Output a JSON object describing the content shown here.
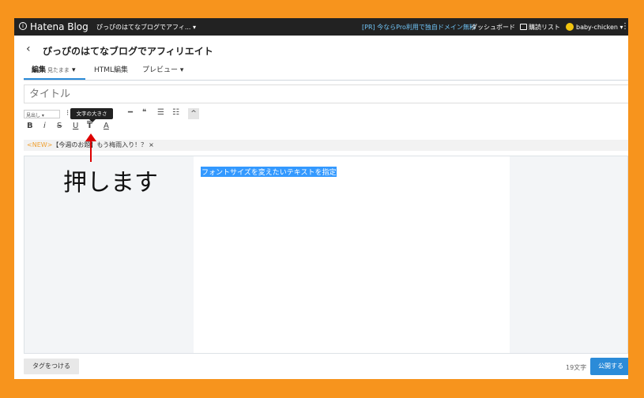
{
  "colors": {
    "frame": "#f7941d",
    "topbar": "#222222",
    "accent": "#2b8bd8",
    "promo": "#6fc3f5",
    "arrow": "#dd0000",
    "selection": "#3399ff",
    "new_badge": "#f0a030"
  },
  "topbar": {
    "brand": "Hatena Blog",
    "blog_selector": "ぴっぴのはてなブログでアフィ... ▾",
    "promo": "[PR] 今ならPro利用で独自ドメイン無料",
    "dashboard": "ダッシュボード",
    "reading_list": "購読リスト",
    "user": "baby-chicken ▾",
    "apps_icon": "grid-icon"
  },
  "header": {
    "back": "‹",
    "title": "ぴっぴのはてなブログでアフィリエイト"
  },
  "tabs": [
    {
      "label": "編集",
      "sub": "見たまま",
      "arrow": "▾"
    },
    {
      "label": "HTML編集"
    },
    {
      "label": "プレビュー",
      "arrow": "▾"
    }
  ],
  "title_field": {
    "placeholder": "タイトル"
  },
  "toolbar": {
    "heading_select": "見出し ▾",
    "tooltip": "文字の大きさ",
    "buttons_row1": [
      "⁝",
      "━",
      "❝",
      "☰",
      "☷"
    ],
    "collapse": "^",
    "format_row": [
      "B",
      "i",
      "S",
      "U",
      "T",
      "A"
    ]
  },
  "notice": {
    "badge": "<NEW>",
    "text": "【今週のお題】もう梅雨入り！？",
    "close": "×"
  },
  "editor": {
    "selected_text": "フォントサイズを変えたいテキストを指定"
  },
  "annotation": {
    "text": "押します"
  },
  "footer": {
    "tag_button": "タグをつける",
    "char_count": "19文字",
    "publish_button": "公開する"
  }
}
